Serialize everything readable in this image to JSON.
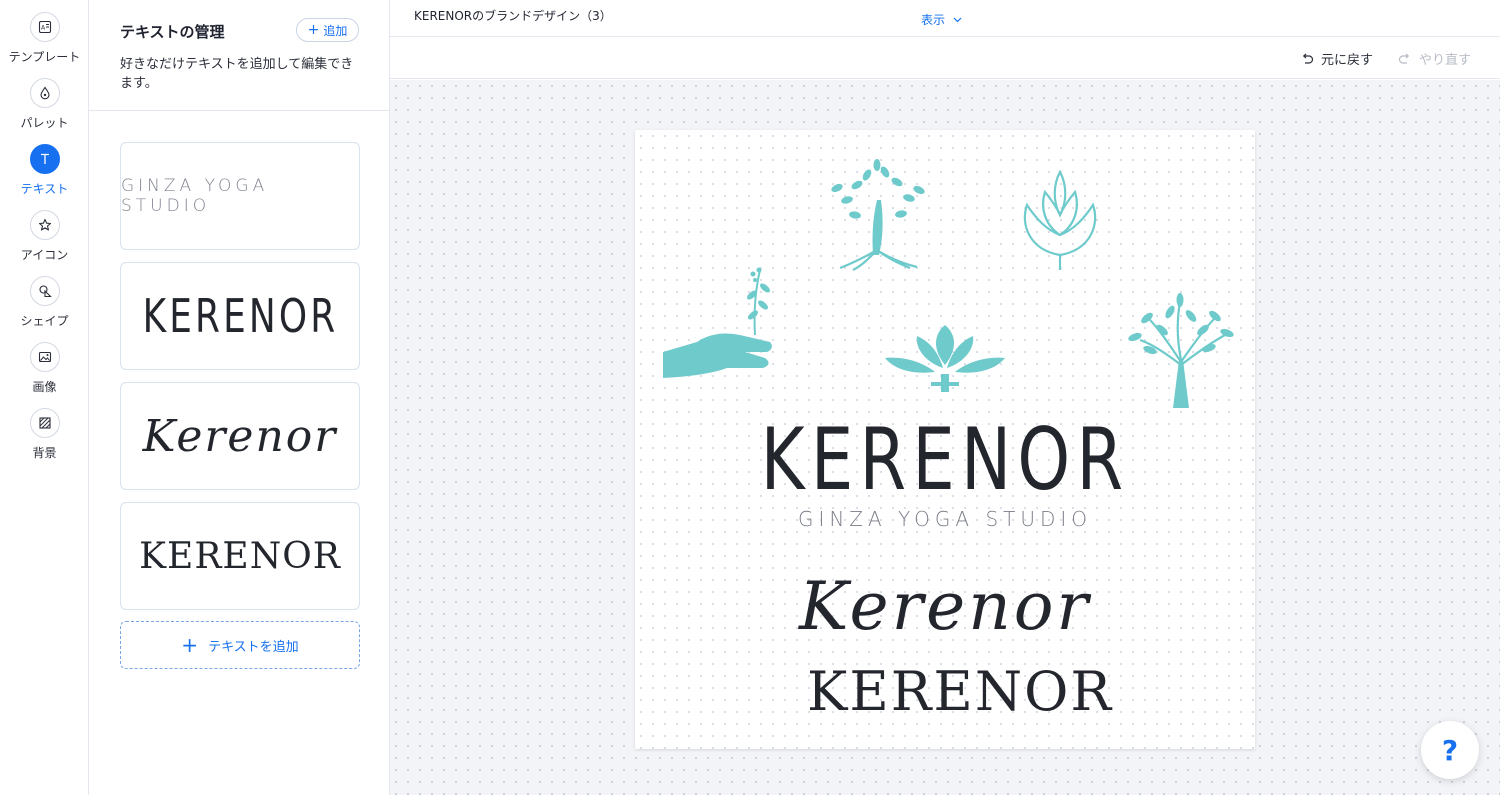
{
  "rail": {
    "items": [
      {
        "label": "テンプレート",
        "icon": "template-icon",
        "active": false
      },
      {
        "label": "パレット",
        "icon": "palette-drop-icon",
        "active": false
      },
      {
        "label": "テキスト",
        "icon": "text-icon",
        "active": true
      },
      {
        "label": "アイコン",
        "icon": "star-icon",
        "active": false
      },
      {
        "label": "シェイプ",
        "icon": "shape-icon",
        "active": false
      },
      {
        "label": "画像",
        "icon": "image-icon",
        "active": false
      },
      {
        "label": "背景",
        "icon": "background-icon",
        "active": false
      }
    ]
  },
  "panel": {
    "title": "テキストの管理",
    "add_label": "追加",
    "description": "好きなだけテキストを追加して編集できます。",
    "cards": [
      {
        "text": "GINZA YOGA STUDIO"
      },
      {
        "text": "KERENOR"
      },
      {
        "text": "Kerenor"
      },
      {
        "text": "KERENOR"
      }
    ],
    "add_text_label": "テキストを追加"
  },
  "topbar": {
    "doc_title": "KERENORのブランドデザイン（3）",
    "view_label": "表示"
  },
  "toolbar": {
    "undo_label": "元に戻す",
    "redo_label": "やり直す"
  },
  "artboard": {
    "title_text": "KERENOR",
    "subtitle_text": "GINZA YOGA STUDIO",
    "script_text": "Kerenor",
    "serif_text": "KERENOR",
    "accent_color": "#6ecacb",
    "icons": [
      "tree-roots-icon",
      "lotus-bud-icon",
      "hand-sprout-icon",
      "lotus-icon",
      "tree-icon"
    ]
  },
  "help": {
    "label": "?"
  }
}
